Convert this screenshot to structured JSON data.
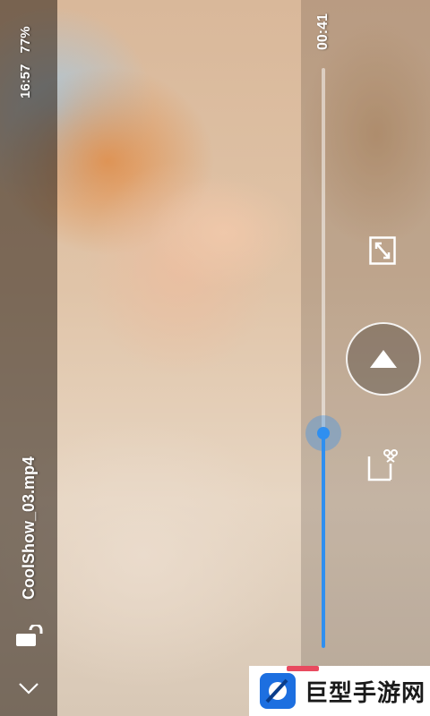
{
  "status_bar": {
    "time": "16:57",
    "battery": "77%"
  },
  "video": {
    "title": "CoolShow_03.mp4",
    "current_time": "00:41",
    "progress_fraction_remaining": 0.37
  },
  "icons": {
    "lock": "lock-icon",
    "collapse": "chevron-down-icon",
    "fullscreen": "fullscreen-icon",
    "play": "play-icon",
    "clip": "scissors-icon"
  },
  "watermark": {
    "text": "巨型手游网"
  },
  "colors": {
    "accent": "#2f8ff0",
    "overlay": "#281e14"
  }
}
